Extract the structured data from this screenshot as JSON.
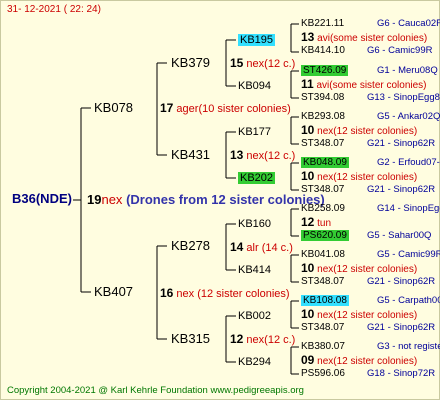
{
  "date": "31- 12-2021 ( 22: 24)",
  "root": {
    "name": "B36(NDE)",
    "number": "19",
    "text": "nex",
    "desc": "(Drones from 12 sister colonies)"
  },
  "gen1": [
    {
      "name": "KB078"
    },
    {
      "name": "KB407"
    }
  ],
  "gen2": [
    {
      "name": "KB379",
      "number": "15",
      "text": "nex",
      "paren": "(12 c.)"
    },
    {
      "name": "KB431",
      "number": "13",
      "text": "nex",
      "paren": "(12 c.)"
    },
    {
      "name": "KB278",
      "number": "14",
      "text": "alr",
      "paren": " (14 c.)"
    },
    {
      "name": "KB315",
      "number": "12",
      "text": "nex",
      "paren": "(12 c.)"
    }
  ],
  "gen1_info": [
    {
      "number": "17",
      "text": "ager",
      "paren": "(10 sister colonies)"
    },
    {
      "number": "16",
      "text": "nex",
      "paren": " (12 sister colonies)"
    }
  ],
  "gen3": [
    {
      "name": "KB195"
    },
    {
      "name": "KB094"
    },
    {
      "name": "KB177"
    },
    {
      "name": "KB202"
    },
    {
      "name": "KB160"
    },
    {
      "name": "KB414"
    },
    {
      "name": "KB002"
    },
    {
      "name": "KB294"
    }
  ],
  "gen4": [
    {
      "top": "KB221.11",
      "mid_num": "13",
      "mid_text": "avi",
      "mid_paren": "(some sister colonies)",
      "bot": "KB414.10",
      "top_right": "G6 - Cauca02R",
      "bot_right": "G6 - Camic99R"
    },
    {
      "top": "ST426.09",
      "mid_num": "11",
      "mid_text": "avi",
      "mid_paren": "(some sister colonies)",
      "bot": "ST394.08",
      "top_right": "G1 - Meru08Q",
      "bot_right": "G13 - SinopEgg86R"
    },
    {
      "top": "KB293.08",
      "mid_num": "10",
      "mid_text": "nex",
      "mid_paren": "(12 sister colonies)",
      "bot": "ST348.07",
      "top_right": "G5 - Ankar02Q",
      "bot_right": "G21 - Sinop62R"
    },
    {
      "top": "KB048.09",
      "mid_num": "10",
      "mid_text": "nex",
      "mid_paren": "(12 sister colonies)",
      "bot": "ST348.07",
      "top_right": "G2 - Erfoud07-1Q",
      "bot_right": "G21 - Sinop62R"
    },
    {
      "top": "KB258.09",
      "mid_num": "12",
      "mid_text": "tun",
      "mid_paren": "",
      "bot": "PS620.09",
      "top_right": "G14 - SinopEgg86R",
      "bot_right": "G5 - Sahar00Q"
    },
    {
      "top": "KB041.08",
      "mid_num": "10",
      "mid_text": "nex",
      "mid_paren": "(12 sister colonies)",
      "bot": "ST348.07",
      "top_right": "G5 - Camic99R",
      "bot_right": "G21 - Sinop62R"
    },
    {
      "top": "KB108.08",
      "mid_num": "10",
      "mid_text": "nex",
      "mid_paren": "(12 sister colonies)",
      "bot": "ST348.07",
      "top_right": "G5 - Carpath00R",
      "bot_right": "G21 - Sinop62R"
    },
    {
      "top": "KB380.07",
      "mid_num": "09",
      "mid_text": "nex",
      "mid_paren": "(12 sister colonies)",
      "bot": "PS596.06",
      "top_right": "G3 - not registe",
      "bot_right": "G18 - Sinop72R"
    }
  ],
  "footer": {
    "copyright": "Copyright 2004-2021 @ Karl Kehrle Foundation",
    "url": "www.pedigreeapis.org"
  },
  "colors": {
    "background": "#fffde0",
    "highlight_cyan": "#33e0ff",
    "highlight_green": "#33cc33",
    "text_red": "#cc0000",
    "text_blue": "#000099"
  }
}
